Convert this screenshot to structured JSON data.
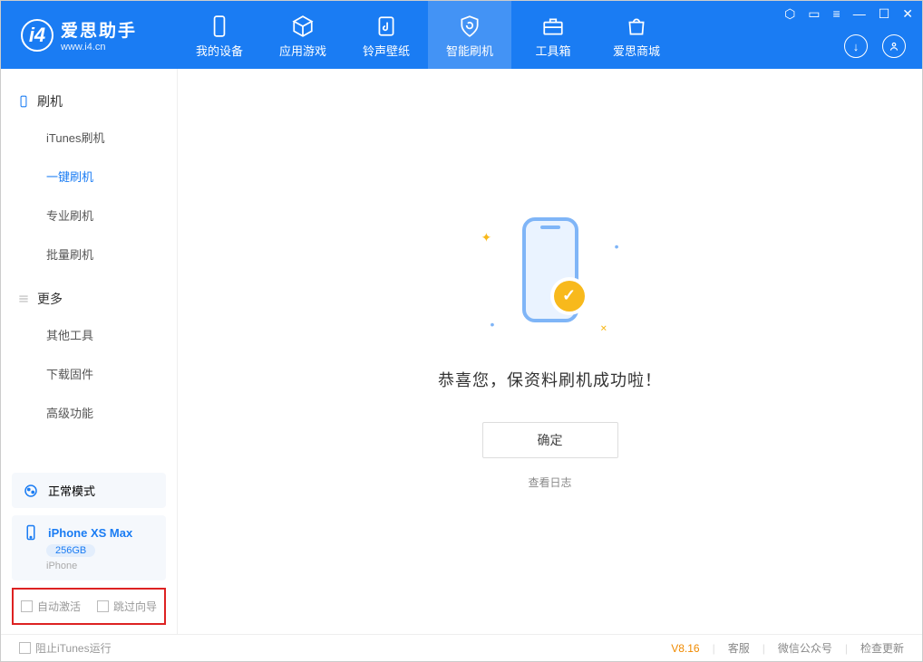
{
  "app": {
    "name": "爱思助手",
    "domain": "www.i4.cn"
  },
  "topnav": [
    {
      "label": "我的设备"
    },
    {
      "label": "应用游戏"
    },
    {
      "label": "铃声壁纸"
    },
    {
      "label": "智能刷机"
    },
    {
      "label": "工具箱"
    },
    {
      "label": "爱思商城"
    }
  ],
  "sidebar": {
    "group1": {
      "title": "刷机",
      "items": [
        "iTunes刷机",
        "一键刷机",
        "专业刷机",
        "批量刷机"
      ]
    },
    "group2": {
      "title": "更多",
      "items": [
        "其他工具",
        "下载固件",
        "高级功能"
      ]
    }
  },
  "mode": {
    "label": "正常模式"
  },
  "device": {
    "name": "iPhone XS Max",
    "capacity": "256GB",
    "type": "iPhone"
  },
  "highlight": {
    "cb1": "自动激活",
    "cb2": "跳过向导"
  },
  "main": {
    "success": "恭喜您，保资料刷机成功啦！",
    "ok": "确定",
    "viewlog": "查看日志"
  },
  "footer": {
    "block_itunes": "阻止iTunes运行",
    "version": "V8.16",
    "links": [
      "客服",
      "微信公众号",
      "检查更新"
    ]
  }
}
